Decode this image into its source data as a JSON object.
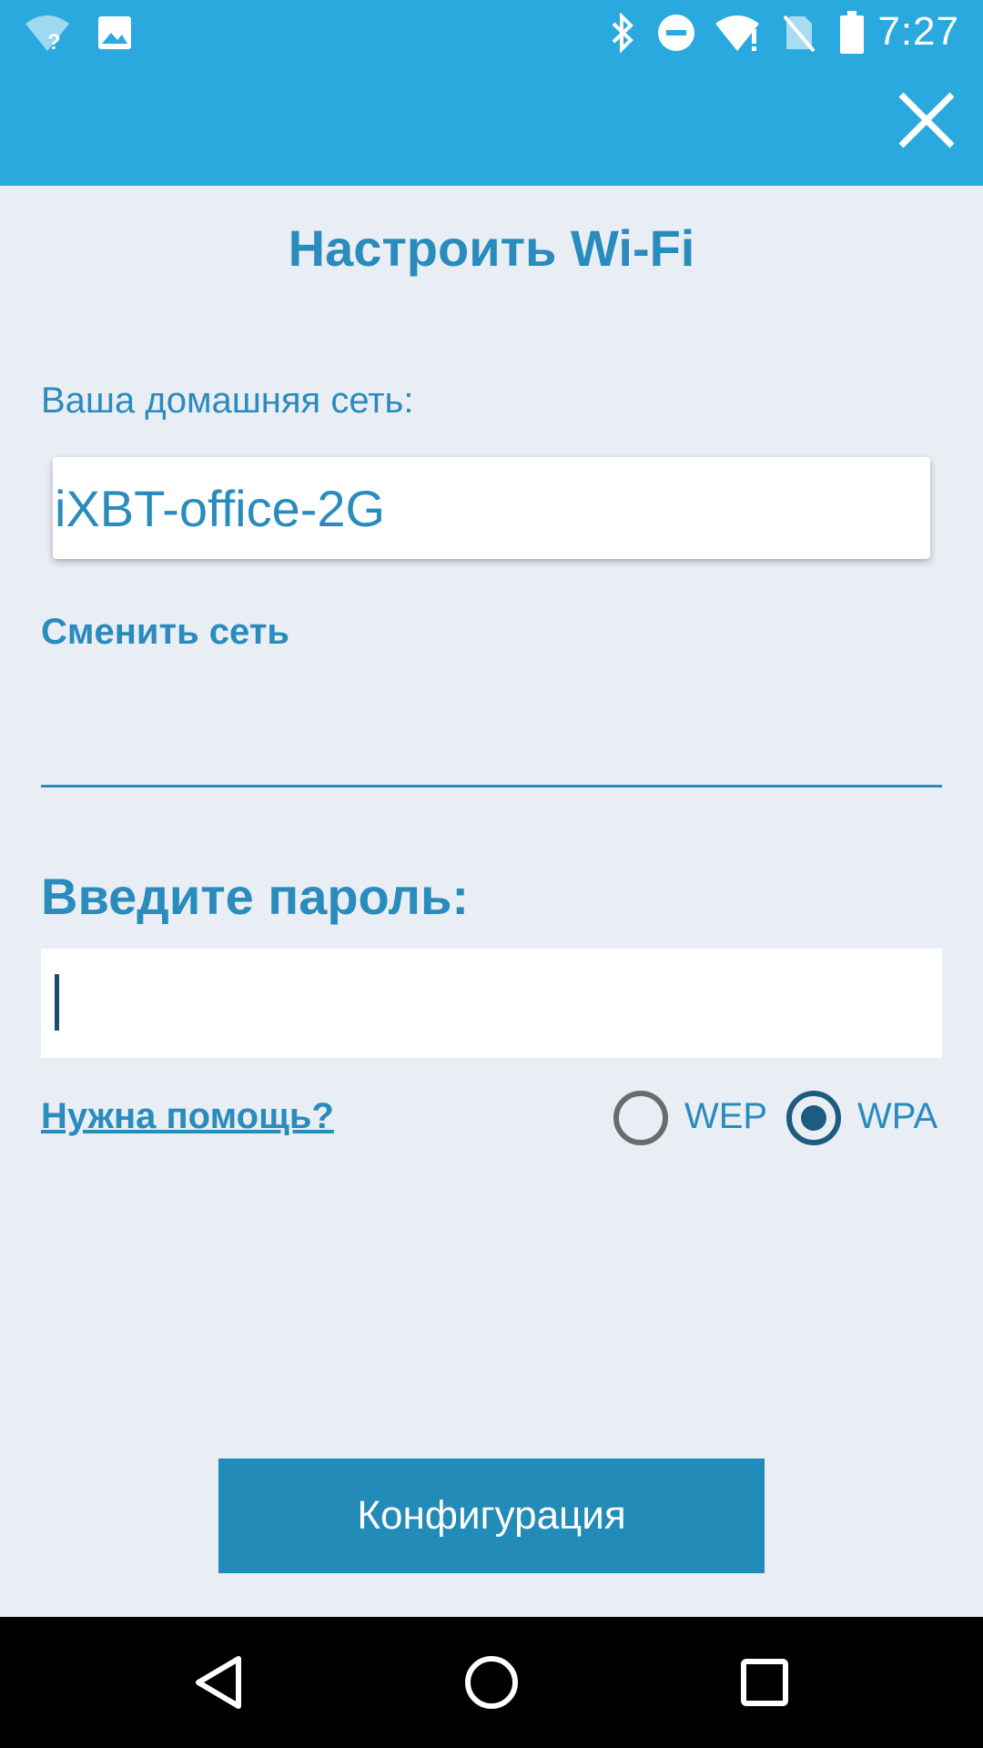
{
  "status_bar": {
    "time": "7:27",
    "icons": [
      "wifi-unknown-icon",
      "image-icon",
      "bluetooth-icon",
      "do-not-disturb-icon",
      "wifi-alert-icon",
      "no-sim-icon",
      "battery-icon"
    ]
  },
  "header": {
    "close_icon": "close-icon",
    "color": "#2aa9df"
  },
  "main": {
    "title": "Настроить Wi-Fi",
    "home_network_label": "Ваша домашняя сеть:",
    "network_name": "iXBT-office-2G",
    "change_network_link": "Сменить сеть",
    "password_label": "Введите пароль:",
    "password_value": "",
    "help_link": "Нужна помощь?",
    "security_options": [
      {
        "label": "WEP",
        "selected": false
      },
      {
        "label": "WPA",
        "selected": true
      }
    ],
    "configure_button": "Конфигурация",
    "accent_color": "#2a8bbd"
  },
  "nav_bar": {
    "icons": [
      "back-icon",
      "home-icon",
      "recents-icon"
    ]
  }
}
